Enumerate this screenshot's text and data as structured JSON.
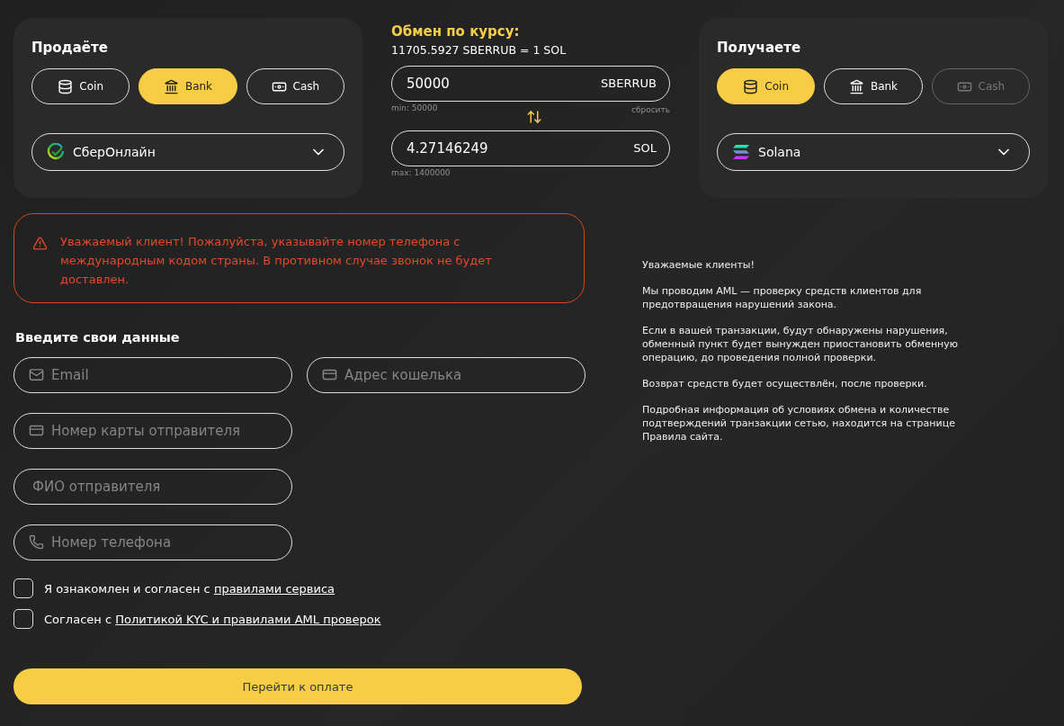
{
  "sell": {
    "title": "Продаёте",
    "methods": [
      {
        "kind": "coin",
        "label": "Coin",
        "selected": false,
        "disabled": false
      },
      {
        "kind": "bank",
        "label": "Bank",
        "selected": true,
        "disabled": false
      },
      {
        "kind": "cash",
        "label": "Cash",
        "selected": false,
        "disabled": false
      }
    ],
    "select": {
      "kind": "sber",
      "value": "СберОнлайн"
    }
  },
  "rate": {
    "title": "Обмен по курсу:",
    "value": "11705.5927 SBERRUB = 1 SOL",
    "give": {
      "value": "50000",
      "currency": "SBERRUB",
      "hint": "min: 50000",
      "action": "сбросить"
    },
    "get": {
      "value": "4.27146249",
      "currency": "SOL",
      "hint": "max: 1400000"
    }
  },
  "receive": {
    "title": "Получаете",
    "methods": [
      {
        "kind": "coin",
        "label": "Coin",
        "selected": true,
        "disabled": false
      },
      {
        "kind": "bank",
        "label": "Bank",
        "selected": false,
        "disabled": false
      },
      {
        "kind": "cash",
        "label": "Cash",
        "selected": false,
        "disabled": true
      }
    ],
    "select": {
      "kind": "solana",
      "value": "Solana"
    }
  },
  "alert": {
    "text": "Уважаемый клиент! Пожалуйста, указывайте номер телефона с международным кодом страны. В противном случае звонок не будет доставлен."
  },
  "form": {
    "title": "Введите свои данные",
    "fields": [
      {
        "kind": "email",
        "placeholder": "Email"
      },
      {
        "kind": "wallet",
        "placeholder": "Адрес кошелька"
      },
      {
        "kind": "card",
        "placeholder": "Номер карты отправителя"
      },
      {
        "kind": "name",
        "placeholder": "ФИО отправителя"
      },
      {
        "kind": "phone",
        "placeholder": "Номер телефона"
      }
    ]
  },
  "agreements": [
    {
      "checked": false,
      "text": "Я ознакомлен и согласен с ",
      "link": "правилами сервиса"
    },
    {
      "checked": false,
      "text": "Согласен с ",
      "link": "Политикой KYC и правилами AML проверок"
    }
  ],
  "submit": "Перейти к оплате",
  "info": [
    "Уважаемые клиенты!",
    "Мы проводим AML — проверку средств клиентов для предотвращения нарушений закона.",
    "Если в вашей транзакции, будут обнаружены нарушения, обменный пункт будет вынужден приостановить обменную операцию, до проведения полной проверки.",
    "Возврат средств будет осуществлён, после проверки.",
    "Подробная информация об условиях обмена и количестве подтверждений транзакции сетью, находится на странице Правила сайта."
  ]
}
